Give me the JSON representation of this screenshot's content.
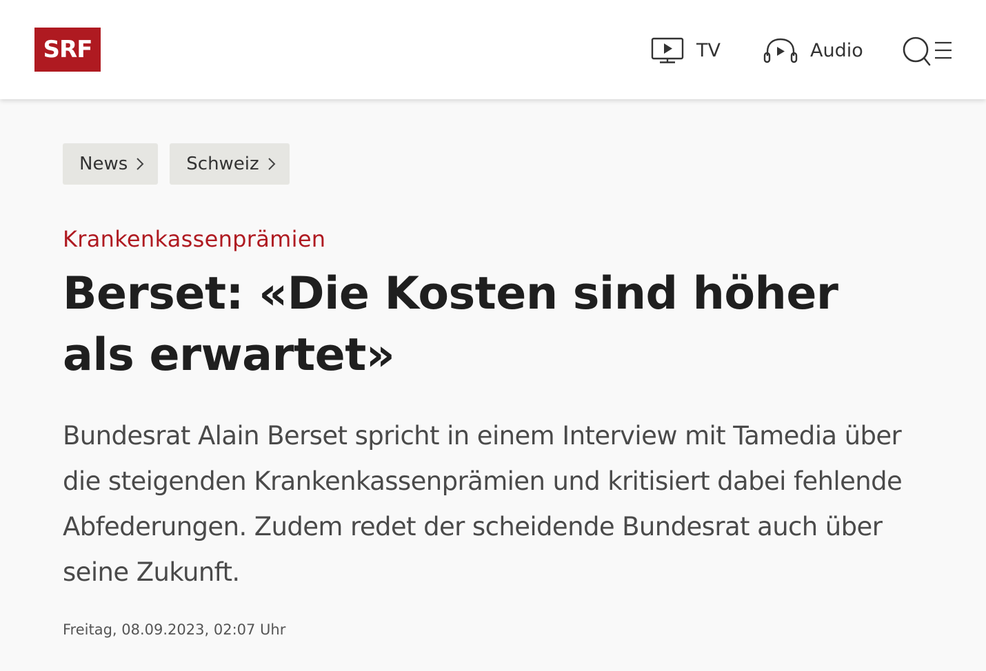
{
  "header": {
    "logo_text": "SRF",
    "brand_color": "#af1a21",
    "nav": {
      "tv_label": "TV",
      "tv_icon": "tv-play-icon",
      "audio_label": "Audio",
      "audio_icon": "headphones-play-icon"
    },
    "search_icon": "search-icon",
    "menu_icon": "menu-icon"
  },
  "breadcrumbs": [
    {
      "label": "News"
    },
    {
      "label": "Schweiz"
    }
  ],
  "article": {
    "kicker": "Krankenkassenprämien",
    "kicker_color": "#af1a21",
    "title": "Berset: «Die Kosten sind höher als erwartet»",
    "lead": "Bundesrat Alain Berset spricht in einem Interview mit Tamedia über die steigenden Krankenkassenprämien und kritisiert dabei fehlende Abfederungen. Zudem redet der scheidende Bundesrat auch über seine Zukunft.",
    "date": "Freitag, 08.09.2023, 02:07 Uhr"
  }
}
